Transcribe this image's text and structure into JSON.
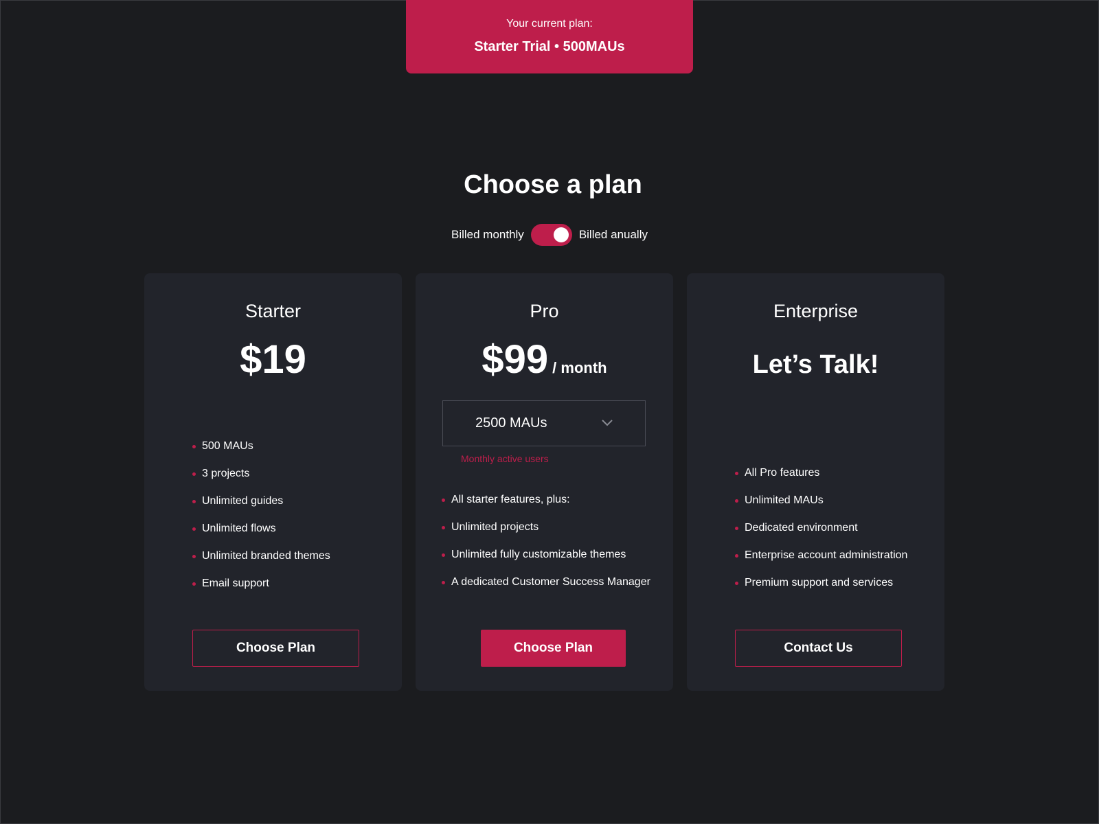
{
  "current_plan": {
    "label": "Your current plan:",
    "value": "Starter Trial • 500MAUs"
  },
  "page_title": "Choose a plan",
  "billing": {
    "monthly_label": "Billed monthly",
    "annual_label": "Billed anually",
    "annual_selected": true
  },
  "colors": {
    "accent": "#be1e4b",
    "background": "#1b1c1f",
    "card": "#22242b"
  },
  "plans": {
    "starter": {
      "title": "Starter",
      "price": "$19",
      "features": [
        "500 MAUs",
        "3 projects",
        "Unlimited guides",
        "Unlimited flows",
        "Unlimited branded themes",
        "Email support"
      ],
      "button_label": "Choose Plan"
    },
    "pro": {
      "title": "Pro",
      "price": "$99",
      "period": "/ month",
      "mau_select": {
        "value": "2500 MAUs",
        "help": "Monthly active users",
        "icon": "chevron-down-icon"
      },
      "features": [
        "All starter features, plus:",
        "Unlimited projects",
        "Unlimited fully customizable themes",
        "A dedicated Customer Success Manager"
      ],
      "button_label": "Choose Plan"
    },
    "enterprise": {
      "title": "Enterprise",
      "price": "Let’s Talk!",
      "features": [
        "All Pro features",
        "Unlimited MAUs",
        "Dedicated environment",
        "Enterprise account administration",
        "Premium support and services"
      ],
      "button_label": "Contact Us"
    }
  }
}
